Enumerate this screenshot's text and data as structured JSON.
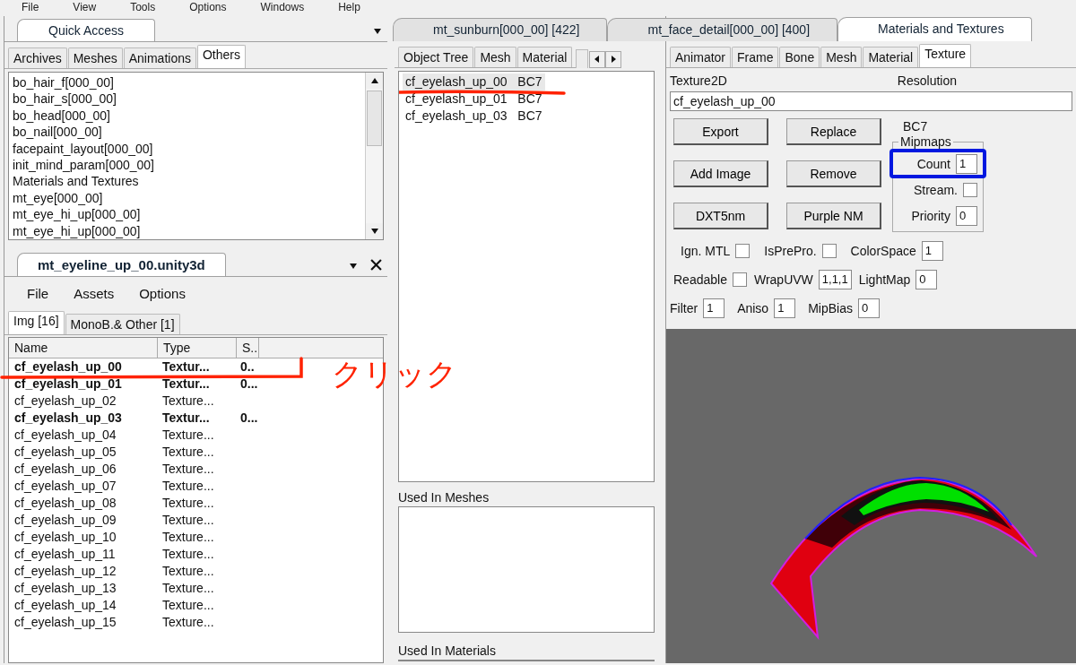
{
  "menu_bar": [
    "File",
    "View",
    "Tools",
    "Options",
    "Windows",
    "Help"
  ],
  "quick_access": {
    "title": "Quick Access",
    "tabs": [
      {
        "label": "Archives",
        "selected": false
      },
      {
        "label": "Meshes",
        "selected": false
      },
      {
        "label": "Animations",
        "selected": false
      },
      {
        "label": "Others",
        "selected": true
      }
    ],
    "items": [
      "bo_hair_f[000_00]",
      "bo_hair_s[000_00]",
      "bo_head[000_00]",
      "bo_nail[000_00]",
      "facepaint_layout[000_00]",
      "init_mind_param[000_00]",
      "Materials and Textures",
      "mt_eye[000_00]",
      "mt_eye_hi_up[000_00]",
      "mt_eye_hi_up[000_00]"
    ]
  },
  "file_panel": {
    "title": "mt_eyeline_up_00.unity3d",
    "menu": [
      "File",
      "Assets",
      "Options"
    ],
    "tabs": [
      {
        "label": "Img [16]",
        "selected": true
      },
      {
        "label": "MonoB.& Other [1]",
        "selected": false
      }
    ],
    "columns": [
      "Name",
      "Type",
      "S.."
    ],
    "rows": [
      {
        "name": "cf_eyelash_up_00",
        "type": "Textur...",
        "size": "0..",
        "modified": true
      },
      {
        "name": "cf_eyelash_up_01",
        "type": "Textur...",
        "size": "0...",
        "modified": true
      },
      {
        "name": "cf_eyelash_up_02",
        "type": "Texture...",
        "modified": false
      },
      {
        "name": "cf_eyelash_up_03",
        "type": "Textur...",
        "size": "0...",
        "modified": true
      },
      {
        "name": "cf_eyelash_up_04",
        "type": "Texture...",
        "modified": false
      },
      {
        "name": "cf_eyelash_up_05",
        "type": "Texture...",
        "modified": false
      },
      {
        "name": "cf_eyelash_up_06",
        "type": "Texture...",
        "modified": false
      },
      {
        "name": "cf_eyelash_up_07",
        "type": "Texture...",
        "modified": false
      },
      {
        "name": "cf_eyelash_up_08",
        "type": "Texture...",
        "modified": false
      },
      {
        "name": "cf_eyelash_up_09",
        "type": "Texture...",
        "modified": false
      },
      {
        "name": "cf_eyelash_up_10",
        "type": "Texture...",
        "modified": false
      },
      {
        "name": "cf_eyelash_up_11",
        "type": "Texture...",
        "modified": false
      },
      {
        "name": "cf_eyelash_up_12",
        "type": "Texture...",
        "modified": false
      },
      {
        "name": "cf_eyelash_up_13",
        "type": "Texture...",
        "modified": false
      },
      {
        "name": "cf_eyelash_up_14",
        "type": "Texture...",
        "modified": false
      },
      {
        "name": "cf_eyelash_up_15",
        "type": "Texture...",
        "modified": false
      }
    ]
  },
  "document_tabs": [
    {
      "label": "mt_sunburn[000_00] [422]",
      "selected": false
    },
    {
      "label": "mt_face_detail[000_00] [400]",
      "selected": false
    },
    {
      "label": "Materials and Textures",
      "selected": true
    }
  ],
  "middle": {
    "tabs": [
      {
        "label": "Object Tree",
        "selected": false
      },
      {
        "label": "Mesh",
        "selected": false
      },
      {
        "label": "Material",
        "selected": false
      }
    ],
    "textures": [
      {
        "name": "cf_eyelash_up_00",
        "format": "BC7",
        "selected": true
      },
      {
        "name": "cf_eyelash_up_01",
        "format": "BC7",
        "selected": false
      },
      {
        "name": "cf_eyelash_up_03",
        "format": "BC7",
        "selected": false
      }
    ],
    "used_in_meshes": "Used In Meshes",
    "used_in_materials": "Used In Materials"
  },
  "texture_editor": {
    "tabs": [
      {
        "label": "Animator",
        "selected": false
      },
      {
        "label": "Frame",
        "selected": false
      },
      {
        "label": "Bone",
        "selected": false
      },
      {
        "label": "Mesh",
        "selected": false
      },
      {
        "label": "Material",
        "selected": false
      },
      {
        "label": "Texture",
        "selected": true
      }
    ],
    "name_label": "Texture2D",
    "resolution_label": "Resolution",
    "name_value": "cf_eyelash_up_00",
    "buttons": [
      "Export",
      "Replace",
      "Add Image",
      "Remove",
      "DXT5nm",
      "Purple NM"
    ],
    "format": "BC7",
    "mipmaps": {
      "title": "Mipmaps",
      "count_label": "Count",
      "count": "1",
      "stream_label": "Stream.",
      "stream": false,
      "priority_label": "Priority",
      "priority": "0"
    },
    "rows": [
      [
        {
          "kind": "check",
          "label": "Ign. MTL",
          "checked": false
        },
        {
          "kind": "check",
          "label": "IsPrePro.",
          "checked": false
        },
        {
          "kind": "field",
          "label": "ColorSpace",
          "value": "1"
        }
      ],
      [
        {
          "kind": "check",
          "label": "Readable",
          "checked": false
        },
        {
          "kind": "field",
          "label": "WrapUVW",
          "value": "1,1,1"
        },
        {
          "kind": "field",
          "label": "LightMap",
          "value": "0"
        }
      ],
      [
        {
          "kind": "field",
          "label": "Filter",
          "value": "1"
        },
        {
          "kind": "field",
          "label": "Aniso",
          "value": "1"
        },
        {
          "kind": "field",
          "label": "MipBias",
          "value": "0"
        }
      ]
    ],
    "preview": {
      "kind": "picture"
    }
  },
  "annotations": [
    {
      "kind": "bracket",
      "color": "#ff2200"
    },
    {
      "kind": "underline",
      "color": "#ff2200"
    },
    {
      "kind": "frame",
      "color": "#0018e0"
    },
    {
      "kind": "label",
      "text": "クリック",
      "color": "#ff2200"
    }
  ]
}
